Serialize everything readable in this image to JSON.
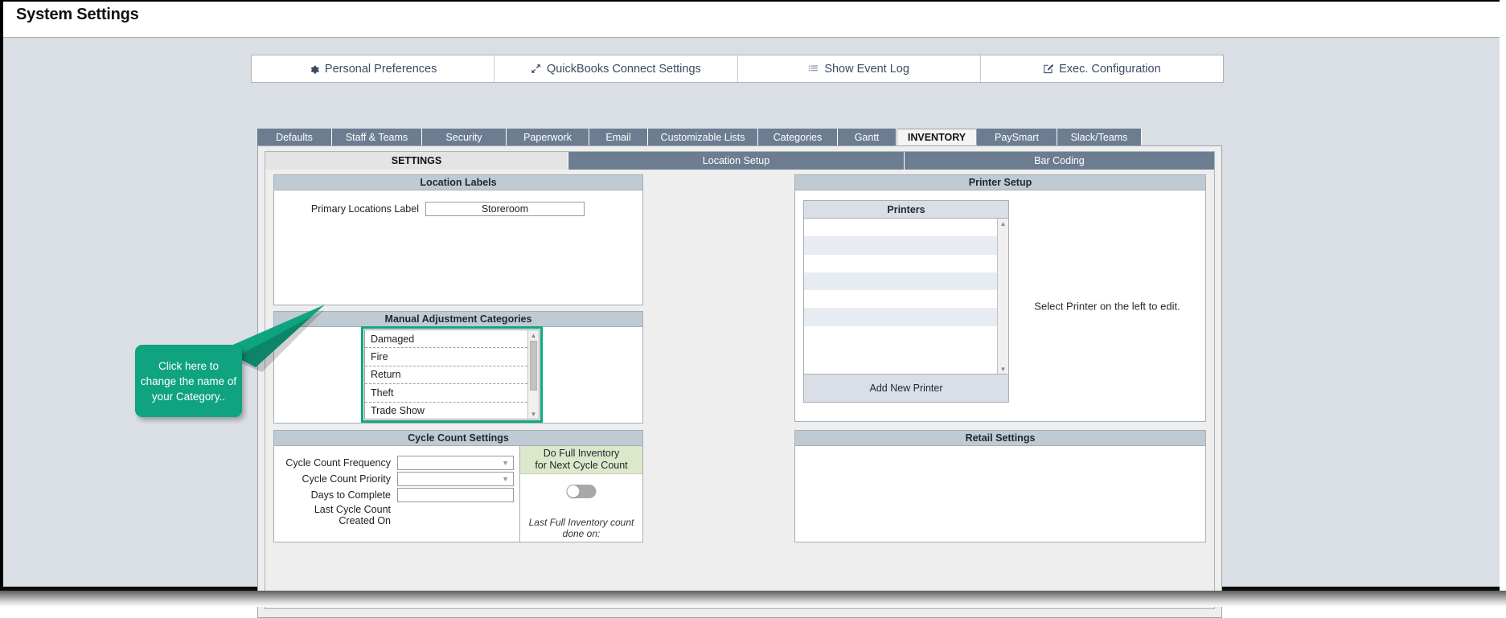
{
  "window": {
    "title": "System Settings"
  },
  "toolbar": {
    "buttons": [
      {
        "label": "Personal Preferences",
        "icon": "gear-icon"
      },
      {
        "label": "QuickBooks Connect Settings",
        "icon": "expand-arrows-icon"
      },
      {
        "label": "Show Event Log",
        "icon": "list-icon"
      },
      {
        "label": "Exec. Configuration",
        "icon": "edit-square-icon"
      }
    ]
  },
  "tabs": {
    "items": [
      {
        "label": "Defaults",
        "active": false
      },
      {
        "label": "Staff & Teams",
        "active": false
      },
      {
        "label": "Security",
        "active": false
      },
      {
        "label": "Paperwork",
        "active": false
      },
      {
        "label": "Email",
        "active": false
      },
      {
        "label": "Customizable Lists",
        "active": false
      },
      {
        "label": "Categories",
        "active": false
      },
      {
        "label": "Gantt",
        "active": false
      },
      {
        "label": "INVENTORY",
        "active": true
      },
      {
        "label": "PaySmart",
        "active": false
      },
      {
        "label": "Slack/Teams",
        "active": false
      }
    ]
  },
  "subtabs": {
    "items": [
      {
        "label": "SETTINGS",
        "active": true
      },
      {
        "label": "Location Setup",
        "active": false
      },
      {
        "label": "Bar Coding",
        "active": false
      }
    ]
  },
  "location_labels": {
    "title": "Location Labels",
    "primary_label": "Primary Locations Label",
    "primary_value": "Storeroom"
  },
  "manual_adjustment_categories": {
    "title": "Manual Adjustment Categories",
    "items": [
      "Damaged",
      "Fire",
      "Return",
      "Theft",
      "Trade Show"
    ]
  },
  "callout": {
    "text": "Click here to change the name of your Category..",
    "color": "#0fa380"
  },
  "cycle_count": {
    "title": "Cycle Count Settings",
    "frequency_label": "Cycle Count Frequency",
    "frequency_value": "",
    "priority_label": "Cycle Count Priority",
    "priority_value": "",
    "days_label": "Days to Complete",
    "days_value": "",
    "last_created_label": "Last Cycle Count Created On",
    "last_created_value": "",
    "full_inventory_header": "Do Full Inventory\nfor Next Cycle Count",
    "full_inventory_toggle": "off",
    "last_full_text": "Last Full Inventory count done on:"
  },
  "printer_setup": {
    "title": "Printer Setup",
    "list_header": "Printers",
    "rows": [
      "",
      "",
      "",
      "",
      "",
      "",
      ""
    ],
    "add_button": "Add New Printer",
    "hint": "Select Printer on the left to edit."
  },
  "retail_settings": {
    "title": "Retail Settings"
  }
}
